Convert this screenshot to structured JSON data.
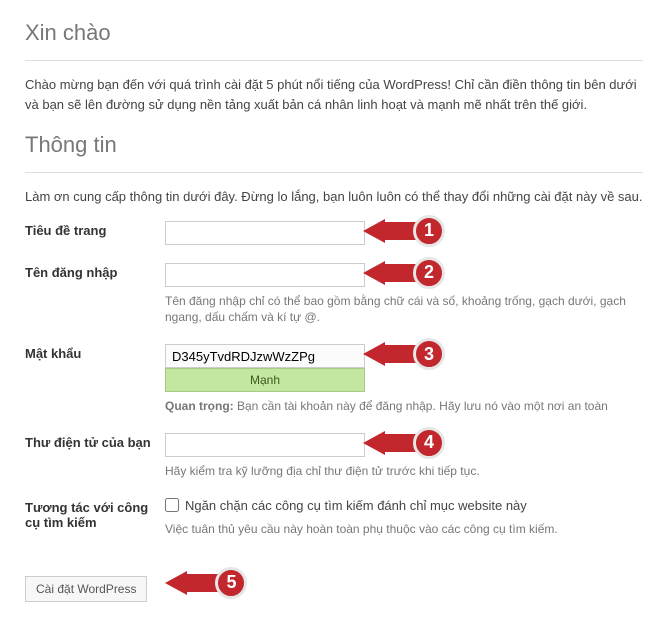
{
  "heading1": "Xin chào",
  "intro": "Chào mừng bạn đến với quá trình cài đặt 5 phút nổi tiếng của WordPress! Chỉ cần điền thông tin bên dưới và bạn sẽ lên đường sử dụng nền tảng xuất bản cá nhân linh hoạt và mạnh mẽ nhất trên thế giới.",
  "heading2": "Thông tin",
  "info_text": "Làm ơn cung cấp thông tin dưới đây. Đừng lo lắng, bạn luôn luôn có thể thay đổi những cài đặt này về sau.",
  "fields": {
    "site_title": {
      "label": "Tiêu đề trang",
      "value": ""
    },
    "username": {
      "label": "Tên đăng nhập",
      "value": "",
      "hint": "Tên đăng nhập chỉ có thể bao gồm bằng chữ cái và số, khoảng trống, gạch dưới, gạch ngang, dấu chấm và kí tự @."
    },
    "password": {
      "label": "Mật khẩu",
      "value": "D345yTvdRDJzwWzZPg",
      "strength": "Mạnh",
      "important_label": "Quan trọng:",
      "important_text": " Bạn cần tài khoản này để đăng nhập. Hãy lưu nó vào một nơi an toàn"
    },
    "email": {
      "label": "Thư điện tử của bạn",
      "value": "",
      "hint": "Hãy kiểm tra kỹ lưỡng địa chỉ thư điện tử trước khi tiếp tục."
    },
    "search_engines": {
      "label": "Tương tác với công cụ tìm kiếm",
      "checkbox_label": "Ngăn chặn các công cụ tìm kiếm đánh chỉ mục website này",
      "hint": "Việc tuân thủ yêu cầu này hoàn toàn phụ thuộc vào các công cụ tìm kiếm."
    }
  },
  "submit": "Cài đặt WordPress",
  "callouts": {
    "c1": "1",
    "c2": "2",
    "c3": "3",
    "c4": "4",
    "c5": "5"
  }
}
